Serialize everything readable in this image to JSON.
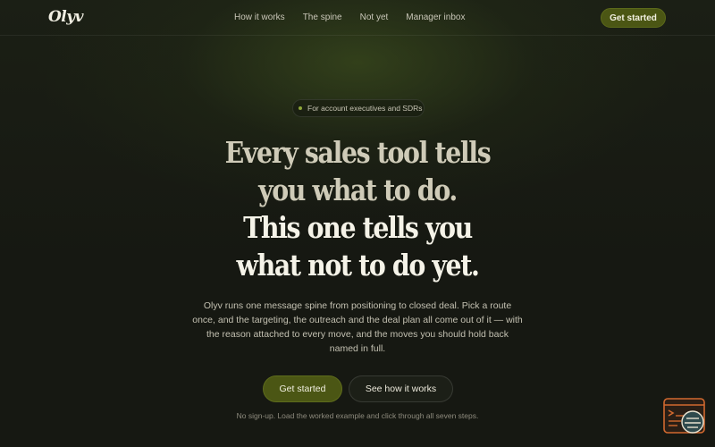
{
  "brand": {
    "logo_text": "Olyv"
  },
  "nav": {
    "links": [
      "How it works",
      "The spine",
      "Not yet",
      "Manager inbox"
    ],
    "cta_label": "Get started"
  },
  "hero": {
    "eyebrow": "For account executives and SDRs",
    "headline": {
      "line1": "Every sales tool tells",
      "line2": "you what to do.",
      "line3": "This one tells you",
      "line4": "what not to do yet."
    },
    "description": "Olyv runs one message spine from positioning to closed deal. Pick a route once, and the targeting, the outreach and the deal plan all come out of it — with the reason attached to every move, and the moves you should hold back named in full.",
    "primary_button": "Get started",
    "secondary_button": "See how it works",
    "note": "No sign-up. Load the worked example and click through all seven steps."
  },
  "widget": {
    "icon": "chat-terminal-icon",
    "accent": "#d2692f"
  },
  "colors": {
    "background": "#161812",
    "accent": "#4b5614",
    "indicator": "#8ea63a"
  }
}
